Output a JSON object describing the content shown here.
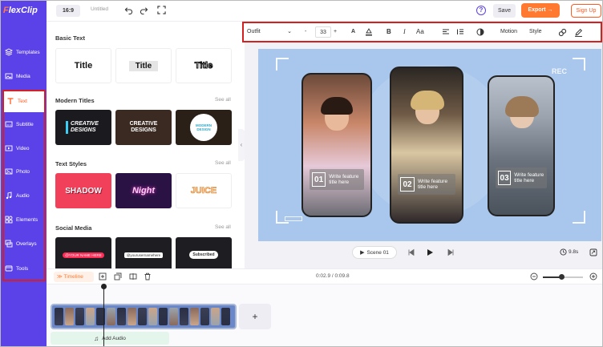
{
  "app": {
    "logo": "FlexClip",
    "logo_first": "F",
    "logo_rest": "lexClip"
  },
  "topbar": {
    "ratio": "16:9",
    "project_name": "Untitled",
    "save": "Save",
    "export": "Export →",
    "signup": "Sign Up",
    "help": "?"
  },
  "sidebar": {
    "items": [
      {
        "label": "Templates",
        "icon": "templates-icon"
      },
      {
        "label": "Media",
        "icon": "media-icon"
      },
      {
        "label": "Text",
        "icon": "text-icon",
        "active": true
      },
      {
        "label": "Subtitle",
        "icon": "subtitle-icon"
      },
      {
        "label": "Video",
        "icon": "video-icon"
      },
      {
        "label": "Photo",
        "icon": "photo-icon"
      },
      {
        "label": "Audio",
        "icon": "audio-icon"
      },
      {
        "label": "Elements",
        "icon": "elements-icon"
      },
      {
        "label": "Overlays",
        "icon": "overlays-icon"
      },
      {
        "label": "Tools",
        "icon": "tools-icon"
      }
    ]
  },
  "panel": {
    "basic_text": {
      "title": "Basic Text",
      "items": [
        "Title",
        "Title",
        "Title"
      ]
    },
    "modern_titles": {
      "title": "Modern Titles",
      "see_all": "See all",
      "items": [
        "CREATIVE DESIGNS",
        "CREATIVE DESIGNS",
        "MODERN DESIGN"
      ]
    },
    "text_styles": {
      "title": "Text Styles",
      "see_all": "See all",
      "items": [
        "SHADOW",
        "Night",
        "JUICE"
      ]
    },
    "social_media": {
      "title": "Social Media",
      "see_all": "See all",
      "items": [
        "@YOUR NAME HERE",
        "@yourusernamehere",
        "Subscribed"
      ]
    }
  },
  "toolbar": {
    "font": "Outfit",
    "size": "33",
    "minus": "-",
    "plus": "+",
    "case": "Aa",
    "motion": "Motion",
    "style": "Style"
  },
  "canvas": {
    "rec": "REC",
    "cards": [
      {
        "num": "01",
        "text": "Write feature title here"
      },
      {
        "num": "02",
        "text": "Write feature title here"
      },
      {
        "num": "03",
        "text": "Write feature title here"
      }
    ]
  },
  "playback": {
    "scene": "Scene 01",
    "duration": "9.8s"
  },
  "timeline": {
    "label": "Timeline",
    "time": "0:02.9 / 0:09.8",
    "zoom_level": 0.45,
    "add_audio": "Add Audio",
    "add_clip": "+"
  },
  "colors": {
    "brand": "#5b41e8",
    "accent": "#ff7a30",
    "highlight": "#d62020",
    "canvas": "#a9c6ec"
  }
}
